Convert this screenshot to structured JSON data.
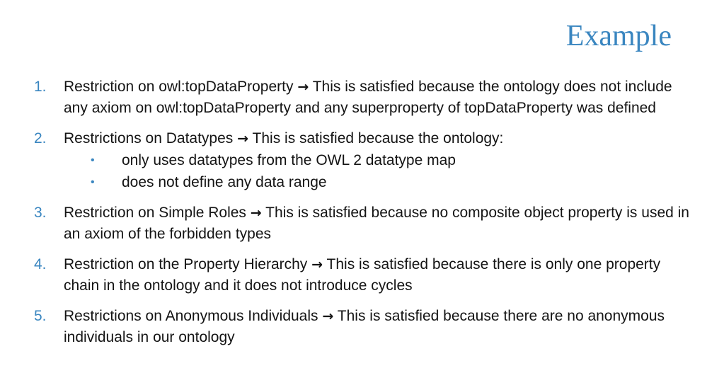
{
  "title": "Example",
  "arrow_glyph": "→",
  "bullet_glyph": "•",
  "accent_color": "#3a86c0",
  "items": [
    {
      "number": "1.",
      "lead": "Restriction on owl:topDataProperty",
      "rest": "This is satisfied because the ontology does not include any axiom on owl:topDataProperty and any superproperty of topDataProperty was defined"
    },
    {
      "number": "2.",
      "lead": "Restrictions on Datatypes",
      "rest": "This is satisfied because the ontology:",
      "bullets": [
        "only uses datatypes from the OWL 2 datatype map",
        "does not define any data range"
      ]
    },
    {
      "number": "3.",
      "lead": "Restriction on Simple Roles",
      "rest": "This is satisfied because no composite object property is used in an axiom of the forbidden types"
    },
    {
      "number": "4.",
      "lead": "Restriction on the Property Hierarchy",
      "rest": "This is satisfied because there is only one property chain in the ontology and it does not introduce cycles"
    },
    {
      "number": "5.",
      "lead": "Restrictions on Anonymous Individuals",
      "rest": "This is satisfied because there are no anonymous individuals in our ontology"
    }
  ]
}
